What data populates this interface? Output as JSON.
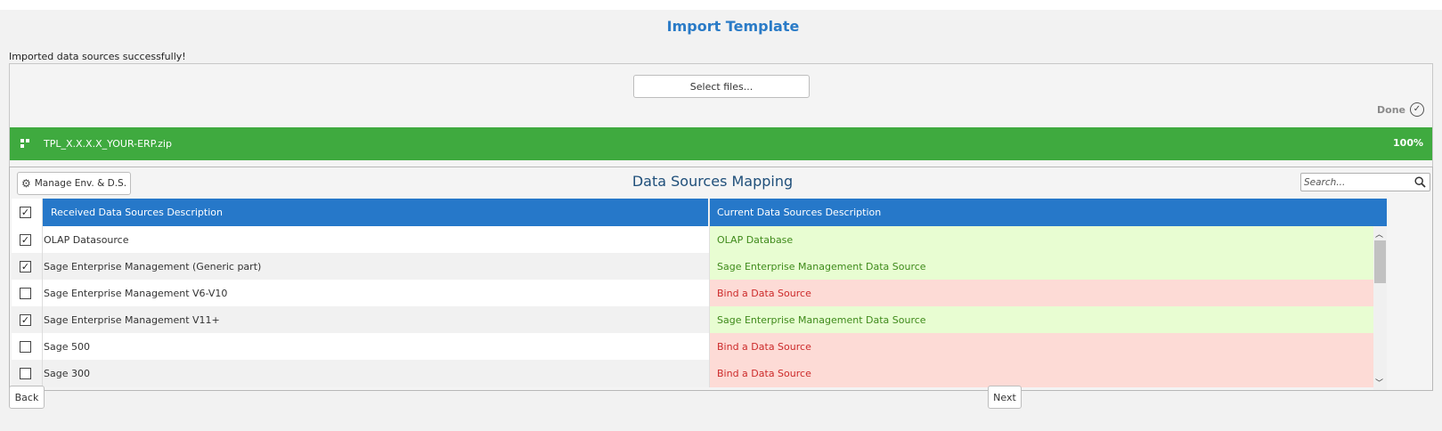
{
  "page": {
    "title": "Import Template"
  },
  "upload": {
    "status_message": "Imported data sources successfully!",
    "select_files_label": "Select files...",
    "done_label": "Done",
    "file": {
      "name": "TPL_X.X.X.X_YOUR-ERP.zip",
      "progress_label": "100%",
      "progress": 1.0
    }
  },
  "mapping": {
    "title": "Data Sources Mapping",
    "manage_button_label": "Manage Env. & D.S.",
    "search_placeholder": "Search...",
    "columns": {
      "received": "Received Data Sources Description",
      "current": "Current Data Sources Description"
    },
    "header_checked": true,
    "rows": [
      {
        "checked": true,
        "received": "OLAP Datasource",
        "current": "OLAP Database",
        "mapped": true
      },
      {
        "checked": true,
        "received": "Sage Enterprise Management (Generic part)",
        "current": "Sage Enterprise Management Data Source",
        "mapped": true
      },
      {
        "checked": false,
        "received": "Sage Enterprise Management V6-V10",
        "current": "Bind a Data Source",
        "mapped": false
      },
      {
        "checked": true,
        "received": "Sage Enterprise Management V11+",
        "current": "Sage Enterprise Management Data Source",
        "mapped": true
      },
      {
        "checked": false,
        "received": "Sage 500",
        "current": "Bind a Data Source",
        "mapped": false
      },
      {
        "checked": false,
        "received": "Sage 300",
        "current": "Bind a Data Source",
        "mapped": false
      }
    ]
  },
  "footer": {
    "back_label": "Back",
    "next_label": "Next"
  },
  "colors": {
    "accent": "#2678c9",
    "success": "#3faa3f",
    "mapped_bg": "#e8fdd2",
    "unmapped_bg": "#fddbd6"
  }
}
